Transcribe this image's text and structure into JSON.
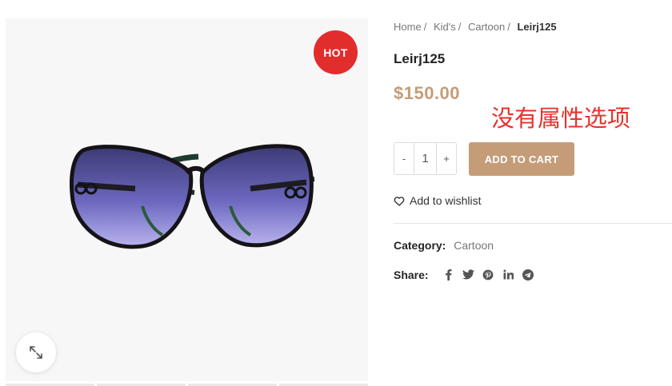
{
  "product": {
    "badge": "HOT",
    "title": "Leirj125",
    "price": "$150.00",
    "annotation": "没有属性选项",
    "quantity": "1",
    "minus_label": "-",
    "plus_label": "+",
    "add_to_cart_label": "ADD TO CART",
    "wishlist_label": "Add to wishlist",
    "category_label": "Category:",
    "category_value": "Cartoon",
    "share_label": "Share:"
  },
  "breadcrumb": {
    "items": [
      "Home",
      "Kid's",
      "Cartoon"
    ],
    "separator": "/",
    "current": "Leirj125"
  },
  "share_icons": [
    "facebook-icon",
    "twitter-icon",
    "pinterest-icon",
    "linkedin-icon",
    "telegram-icon"
  ],
  "colors": {
    "accent": "#c59c78",
    "hot_badge": "#e22d2d",
    "annotation": "#e8322b"
  }
}
